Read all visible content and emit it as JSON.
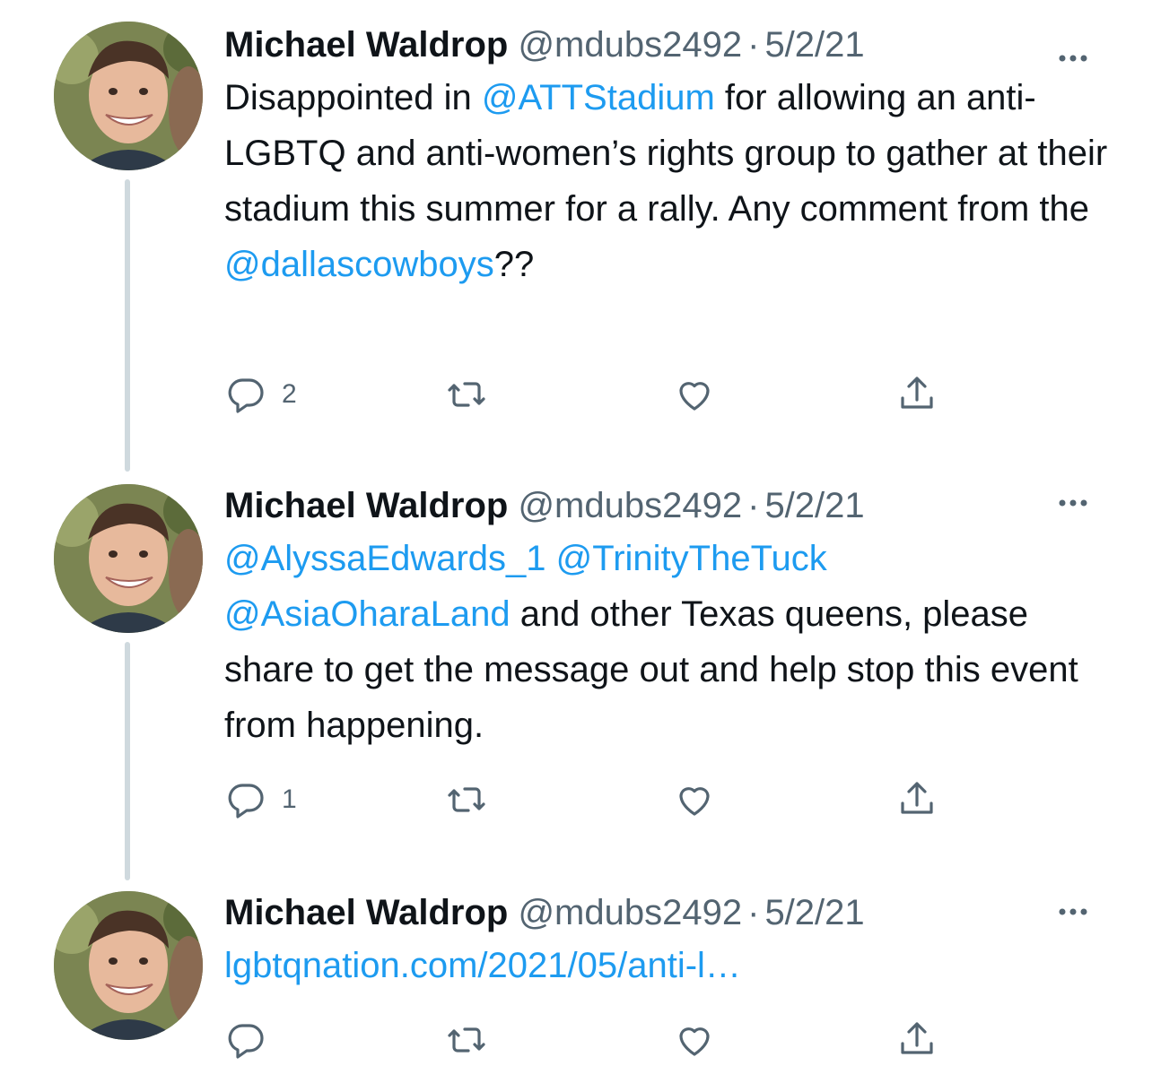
{
  "colors": {
    "link": "#1d9bf0",
    "secondary": "#536471",
    "thread_line": "#cfd9de"
  },
  "tweets": [
    {
      "author_name": "Michael Waldrop",
      "handle": "@mdubs2492",
      "separator": "·",
      "date": "5/2/21",
      "body": [
        {
          "text": "Disappointed in "
        },
        {
          "text": "@ATTStadium",
          "link": true
        },
        {
          "text": " for allowing an anti-LGBTQ and anti-women’s rights group to gather at their stadium this summer for a rally. Any comment from the "
        },
        {
          "text": "@dallascowboys",
          "link": true
        },
        {
          "text": "??"
        }
      ],
      "reply_count": "2",
      "retweet_count": "",
      "like_count": ""
    },
    {
      "author_name": "Michael Waldrop",
      "handle": "@mdubs2492",
      "separator": "·",
      "date": "5/2/21",
      "body": [
        {
          "text": "@AlyssaEdwards_1",
          "link": true
        },
        {
          "text": " "
        },
        {
          "text": "@TrinityTheTuck",
          "link": true
        },
        {
          "text": " "
        },
        {
          "text": "@AsiaOharaLand",
          "link": true
        },
        {
          "text": " and other Texas queens, please share to get the message out and help stop this event from happening."
        }
      ],
      "reply_count": "1",
      "retweet_count": "",
      "like_count": ""
    },
    {
      "author_name": "Michael Waldrop",
      "handle": "@mdubs2492",
      "separator": "·",
      "date": "5/2/21",
      "body": [
        {
          "text": "lgbtqnation.com/2021/05/anti-l…",
          "link": true
        }
      ],
      "reply_count": "",
      "retweet_count": "",
      "like_count": ""
    }
  ],
  "icons": {
    "more": "more-horizontal-icon",
    "reply": "reply-bubble-icon",
    "retweet": "retweet-icon",
    "like": "heart-icon",
    "share": "share-upload-icon"
  }
}
